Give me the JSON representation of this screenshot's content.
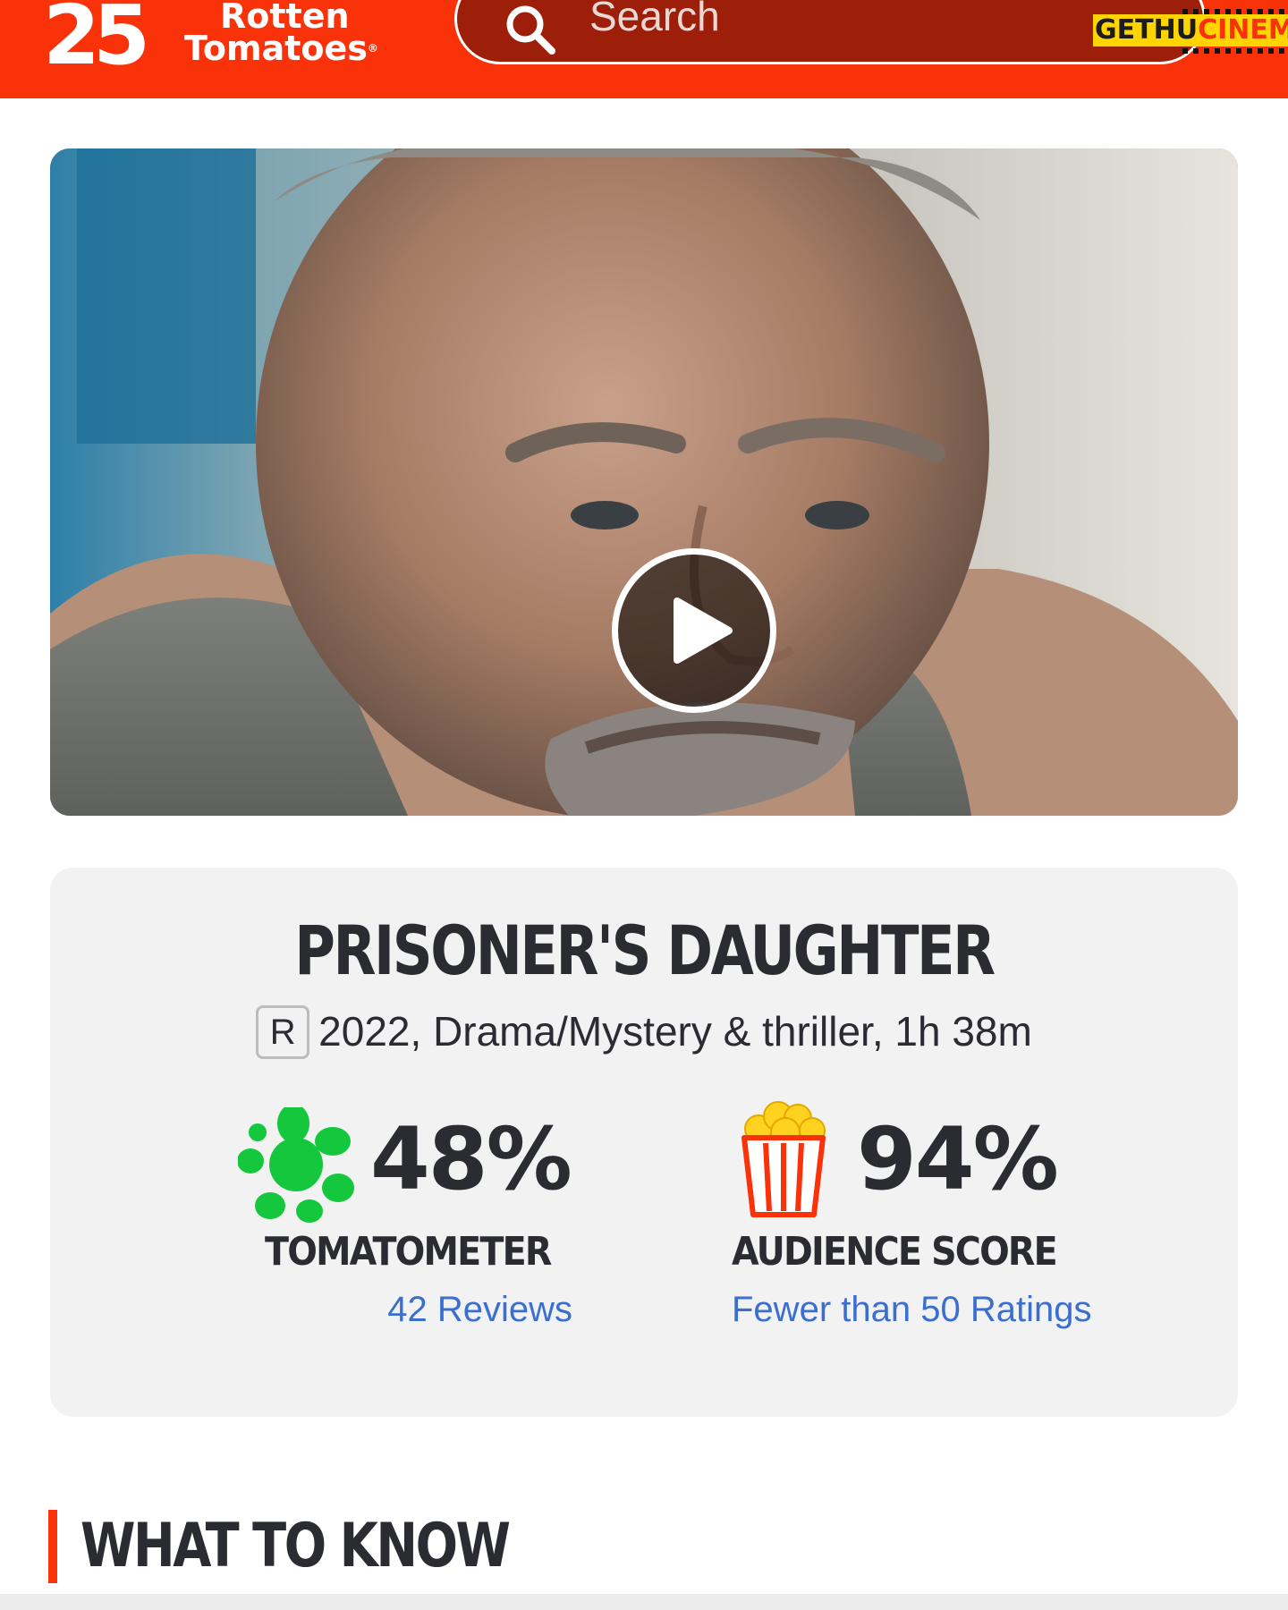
{
  "header": {
    "logo_line1": "Rotten",
    "logo_line2": "Tomatoes",
    "logo_tm": "®",
    "logo_mark": "25",
    "search_placeholder": "Search",
    "brand_color": "#fa320a"
  },
  "watermark": {
    "part1": "GETHU",
    "part2": "CINEMA"
  },
  "video": {
    "play_icon": "play-icon"
  },
  "movie": {
    "title": "PRISONER'S DAUGHTER",
    "rating": "R",
    "info": "2022, Drama/Mystery & thriller, 1h 38m"
  },
  "scores": {
    "tomatometer": {
      "value": "48%",
      "label": "TOMATOMETER",
      "link": "42 Reviews",
      "icon": "rotten-splat-icon",
      "icon_color": "#14c73c"
    },
    "audience": {
      "value": "94%",
      "label": "AUDIENCE SCORE",
      "link": "Fewer than 50 Ratings",
      "icon": "popcorn-icon",
      "icon_color": "#fa320a"
    }
  },
  "section": {
    "what_to_know": "WHAT TO KNOW"
  }
}
